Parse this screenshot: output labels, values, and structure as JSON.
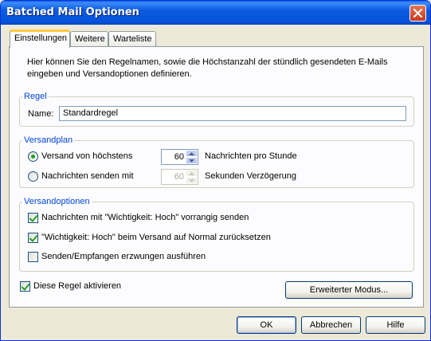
{
  "window": {
    "title": "Batched Mail Optionen"
  },
  "tabs": [
    {
      "label": "Einstellungen"
    },
    {
      "label": "Weitere"
    },
    {
      "label": "Warteliste"
    }
  ],
  "intro_text": "Hier können Sie den Regelnamen, sowie die Höchstanzahl der stündlich gesendeten E-Mails eingeben und Versandoptionen definieren.",
  "regel": {
    "legend": "Regel",
    "name_label": "Name:",
    "name_value": "Standardregel"
  },
  "versandplan": {
    "legend": "Versandplan",
    "option1": {
      "label": "Versand von höchstens",
      "value": "60",
      "unit": "Nachrichten pro Stunde",
      "selected": true
    },
    "option2": {
      "label": "Nachrichten senden mit",
      "value": "60",
      "unit": "Sekunden Verzögerung",
      "selected": false
    }
  },
  "versandoptionen": {
    "legend": "Versandoptionen",
    "items": [
      {
        "label": "Nachrichten mit \"Wichtigkeit: Hoch\" vorrangig senden",
        "checked": true
      },
      {
        "label": "\"Wichtigkeit: Hoch\" beim Versand auf Normal zurücksetzen",
        "checked": true
      },
      {
        "label": "Senden/Empfangen erzwungen ausführen",
        "checked": false
      }
    ]
  },
  "activate": {
    "label": "Diese Regel aktivieren",
    "checked": true
  },
  "buttons": {
    "advanced": "Erweiterter Modus...",
    "ok": "OK",
    "cancel": "Abbrechen",
    "help": "Hilfe"
  },
  "colors": {
    "titlebar": "#0553d8",
    "legend": "#0046d5",
    "tab_highlight": "#ffc83c",
    "check": "#21a121"
  }
}
